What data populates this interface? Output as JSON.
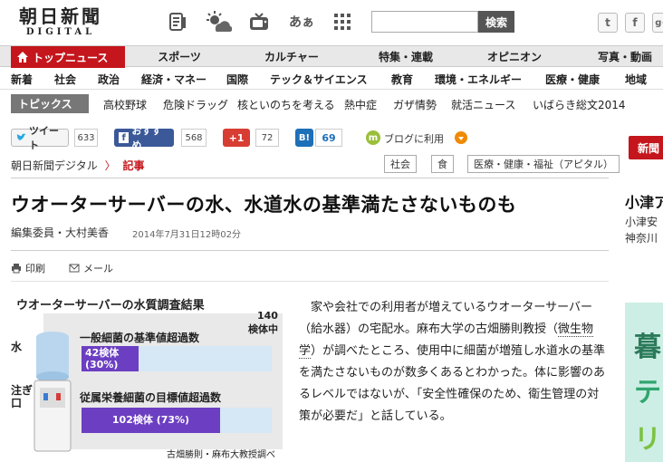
{
  "header": {
    "logo_main": "朝日新聞",
    "logo_sub": "DIGITAL",
    "icons": [
      "newspaper-icon",
      "weather-icon",
      "tv-icon",
      "font-size-icon",
      "grid-menu-icon"
    ],
    "font_glyph": "あぁ",
    "search_placeholder": "",
    "search_button": "検索",
    "social": [
      {
        "name": "twitter-icon",
        "glyph": "t"
      },
      {
        "name": "facebook-icon",
        "glyph": "f"
      },
      {
        "name": "google-plus-icon",
        "glyph": "g+"
      }
    ]
  },
  "main_nav": {
    "active": "トップニュース",
    "items": [
      "スポーツ",
      "カルチャー",
      "特集・連載",
      "オピニオン",
      "写真・動画"
    ]
  },
  "sub_nav": {
    "items": [
      "新着",
      "社会",
      "政治",
      "経済・マネー",
      "国際",
      "テック＆サイエンス",
      "教育",
      "環境・エネルギー",
      "医療・健康",
      "地域"
    ]
  },
  "topics": {
    "label": "トピックス",
    "items": [
      "高校野球",
      "危険ドラッグ",
      "核といのちを考える",
      "熱中症",
      "ガザ情勢",
      "就活ニュース",
      "いばらき総文2014"
    ]
  },
  "share": {
    "tweet_label": "ツイート",
    "tweet_count": "633",
    "facebook_label": "おすすめ",
    "facebook_count": "568",
    "gplus_label": "+1",
    "gplus_count": "72",
    "hatena_label": "B!",
    "hatena_count": "69",
    "blog_label": "ブログに利用"
  },
  "breadcrumb": {
    "home": "朝日新聞デジタル",
    "separator": "〉",
    "current": "記事"
  },
  "tags": [
    "社会",
    "食",
    "医療・健康・福祉（アピタル）"
  ],
  "article": {
    "title": "ウオーターサーバーの水、水道水の基準満たさないものも",
    "byline": "編集委員・大村美香",
    "date": "2014年7月31日12時02分",
    "print_label": "印刷",
    "mail_label": "メール",
    "body_before": "家や会社での利用者が増えているウオーターサーバー（給水器）の宅配水。麻布大学の古畑勝則教授（",
    "body_link": "微生物学",
    "body_after": "）が調べたところ、使用中に細菌が増殖し水道水の基準を満たさないものが数多くあるとわかった。体に影響のあるレベルではないが、「安全性確保のため、衛生管理の対策が必要だ」と話している。"
  },
  "infographic": {
    "title": "ウオーターサーバーの水質調査結果",
    "total_label_1": "140",
    "total_label_2": "検体中",
    "side_water": "水",
    "side_spout_1": "注ぎ",
    "side_spout_2": "口",
    "bar1_title": "一般細菌の基準値超過数",
    "bar1_value_1": "42検体",
    "bar1_value_2": "(30%)",
    "bar1_fraction": 0.3,
    "bar2_title": "従属栄養細菌の目標値超過数",
    "bar2_value": "102検体 (73%)",
    "bar2_fraction": 0.73,
    "note": "古畑勝則・麻布大教授調べ",
    "colors": {
      "fill": "#6c3fc2",
      "track": "#d6e7f5"
    }
  },
  "right_col": {
    "button": "新聞",
    "headline": "小津ア",
    "sub1": "小津安",
    "sub2": "神奈川",
    "ad_1": "暮",
    "ad_2": "テ",
    "ad_3": "リ"
  }
}
